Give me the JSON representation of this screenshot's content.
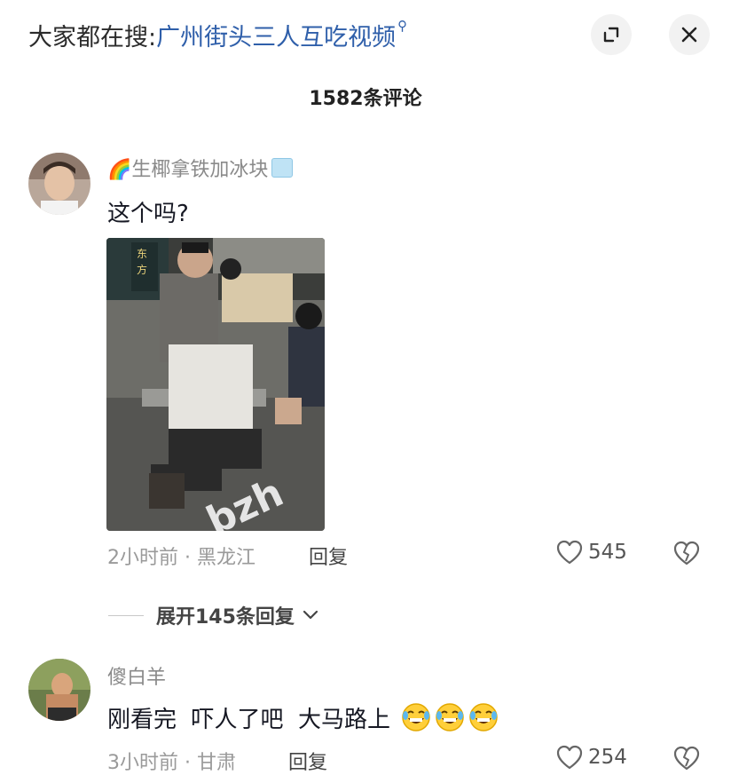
{
  "header": {
    "search_prefix": "大家都在搜:",
    "search_keyword": "广州街头三人互吃视频",
    "comment_count": "1582条评论"
  },
  "comments": [
    {
      "username": "生椰拿铁加冰块",
      "text": "这个吗?",
      "time": "2小时前",
      "location": "黑龙江",
      "reply_label": "回复",
      "likes": "545",
      "expand_label": "展开145条回复"
    },
    {
      "username": "傻白羊",
      "text": "刚看完  吓人了吧  大马路上",
      "time": "3小时前",
      "location": "甘肃",
      "reply_label": "回复",
      "likes": "254",
      "emoji_count": 3
    }
  ],
  "watermark": "bzh",
  "colors": {
    "keyword": "#2f5faa",
    "meta_gray": "#9a9a9a",
    "username_gray": "#8a8a8a"
  }
}
